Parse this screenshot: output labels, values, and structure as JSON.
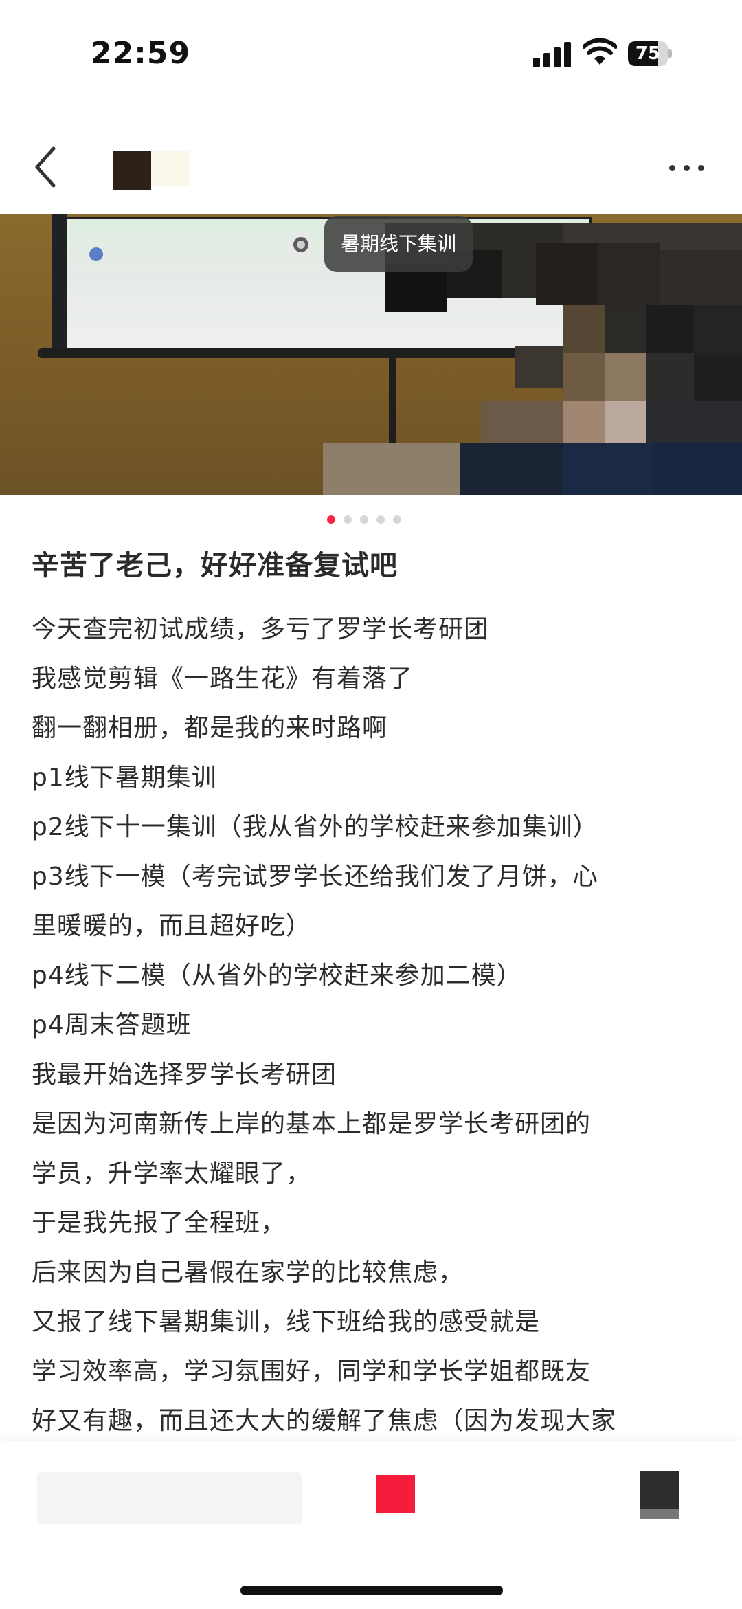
{
  "status": {
    "time": "22:59",
    "battery": "75",
    "battery_level": 0.75
  },
  "nav": {
    "back_icon": "chevron-left-icon",
    "more_icon": "more-dots-icon"
  },
  "photo": {
    "tag": "暑期线下集训",
    "page_count": 5,
    "active_page": 1
  },
  "post": {
    "title": "辛苦了老己，好好准备复试吧",
    "lines": [
      "今天查完初试成绩，多亏了罗学长考研团",
      "我感觉剪辑《一路生花》有着落了",
      "翻一翻相册，都是我的来时路啊",
      "p1线下暑期集训",
      "p2线下十一集训（我从省外的学校赶来参加集训）",
      "p3线下一模（考完试罗学长还给我们发了月饼，心",
      "里暖暖的，而且超好吃）",
      "p4线下二模（从省外的学校赶来参加二模）",
      "p4周末答题班",
      "我最开始选择罗学长考研团",
      "是因为河南新传上岸的基本上都是罗学长考研团的",
      "学员，升学率太耀眼了，",
      "于是我先报了全程班，",
      "后来因为自己暑假在家学的比较焦虑，",
      "又报了线下暑期集训，线下班给我的感受就是",
      "学习效率高，学习氛围好，同学和学长学姐都既友",
      "好又有趣，而且还大大的缓解了焦虑（因为发现大家"
    ]
  },
  "colors": {
    "accent": "#ff2442",
    "text": "#2c2c2c"
  }
}
